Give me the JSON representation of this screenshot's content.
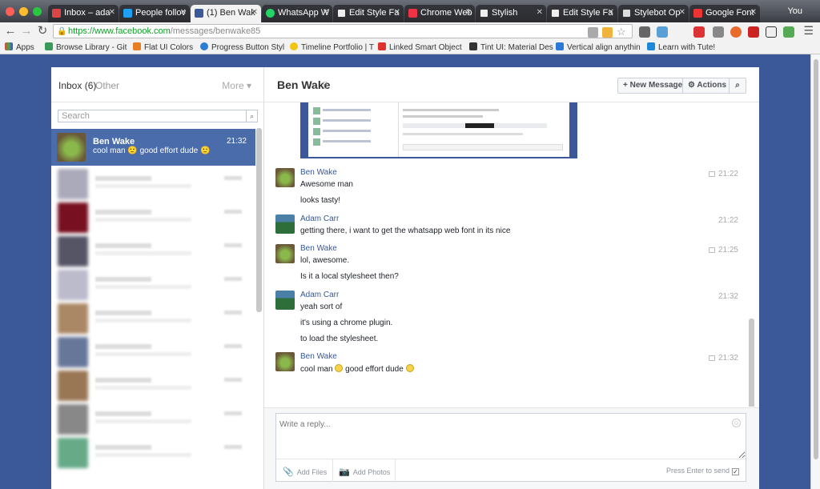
{
  "browser": {
    "tabs": [
      {
        "title": "Inbox – ada"
      },
      {
        "title": "People follov"
      },
      {
        "title": "(1) Ben Wak"
      },
      {
        "title": "WhatsApp W"
      },
      {
        "title": "Edit Style Fa"
      },
      {
        "title": "Chrome Web"
      },
      {
        "title": "Stylish"
      },
      {
        "title": "Edit Style Fa"
      },
      {
        "title": "Stylebot Op"
      },
      {
        "title": "Google Font"
      }
    ],
    "profile": "You",
    "url_host": "https://www.facebook.com",
    "url_path": "/messages/benwake85",
    "bookmarks": [
      {
        "label": "Apps",
        "color": "#d44"
      },
      {
        "label": "Browse Library - Git",
        "color": "#3a9a5a"
      },
      {
        "label": "Flat UI Colors",
        "color": "#e67e22"
      },
      {
        "label": "Progress Button Styl",
        "color": "#2d7dd2"
      },
      {
        "label": "Timeline Portfolio | T",
        "color": "#f1c40f"
      },
      {
        "label": "Linked Smart Object",
        "color": "#e03131"
      },
      {
        "label": "Tint UI: Material Des",
        "color": "#333333"
      },
      {
        "label": "Vertical align anythin",
        "color": "#2b7bd6"
      },
      {
        "label": "Learn with Tute!",
        "color": "#1c8ad9"
      }
    ]
  },
  "inbox": {
    "inbox_label": "Inbox",
    "inbox_count": "(6)",
    "other_label": "Other",
    "more_label": "More ▾",
    "search_placeholder": "Search",
    "selected_thread": {
      "name": "Ben Wake",
      "snippet": "cool man 🙂 good effort dude 🙂",
      "time": "21:32"
    }
  },
  "conversation": {
    "name": "Ben Wake",
    "new_message": "+ New Message",
    "actions": "⚙ Actions",
    "messages": [
      {
        "sender": "Ben Wake",
        "time": "21:22",
        "lines": [
          "Awesome man",
          "looks tasty!"
        ]
      },
      {
        "sender": "Adam Carr",
        "time": "21:22",
        "lines": [
          "getting there, i want to get the whatsapp web font in its nice"
        ]
      },
      {
        "sender": "Ben Wake",
        "time": "21:25",
        "lines": [
          "lol, awesome.",
          "Is it a local stylesheet then?"
        ]
      },
      {
        "sender": "Adam Carr",
        "time": "21:32",
        "lines": [
          "yeah sort of",
          "it's using a chrome plugin.",
          "to load the stylesheet."
        ]
      },
      {
        "sender": "Ben Wake",
        "time": "21:32",
        "lines": [
          "cool man",
          "good effort dude"
        ]
      }
    ],
    "compose": {
      "placeholder": "Write a reply...",
      "add_files": "Add Files",
      "add_photos": "Add Photos",
      "press_enter": "Press Enter to send"
    }
  },
  "colors": {
    "fb_blue": "#3b5998",
    "selected": "#4a6caa",
    "link": "#365899"
  }
}
